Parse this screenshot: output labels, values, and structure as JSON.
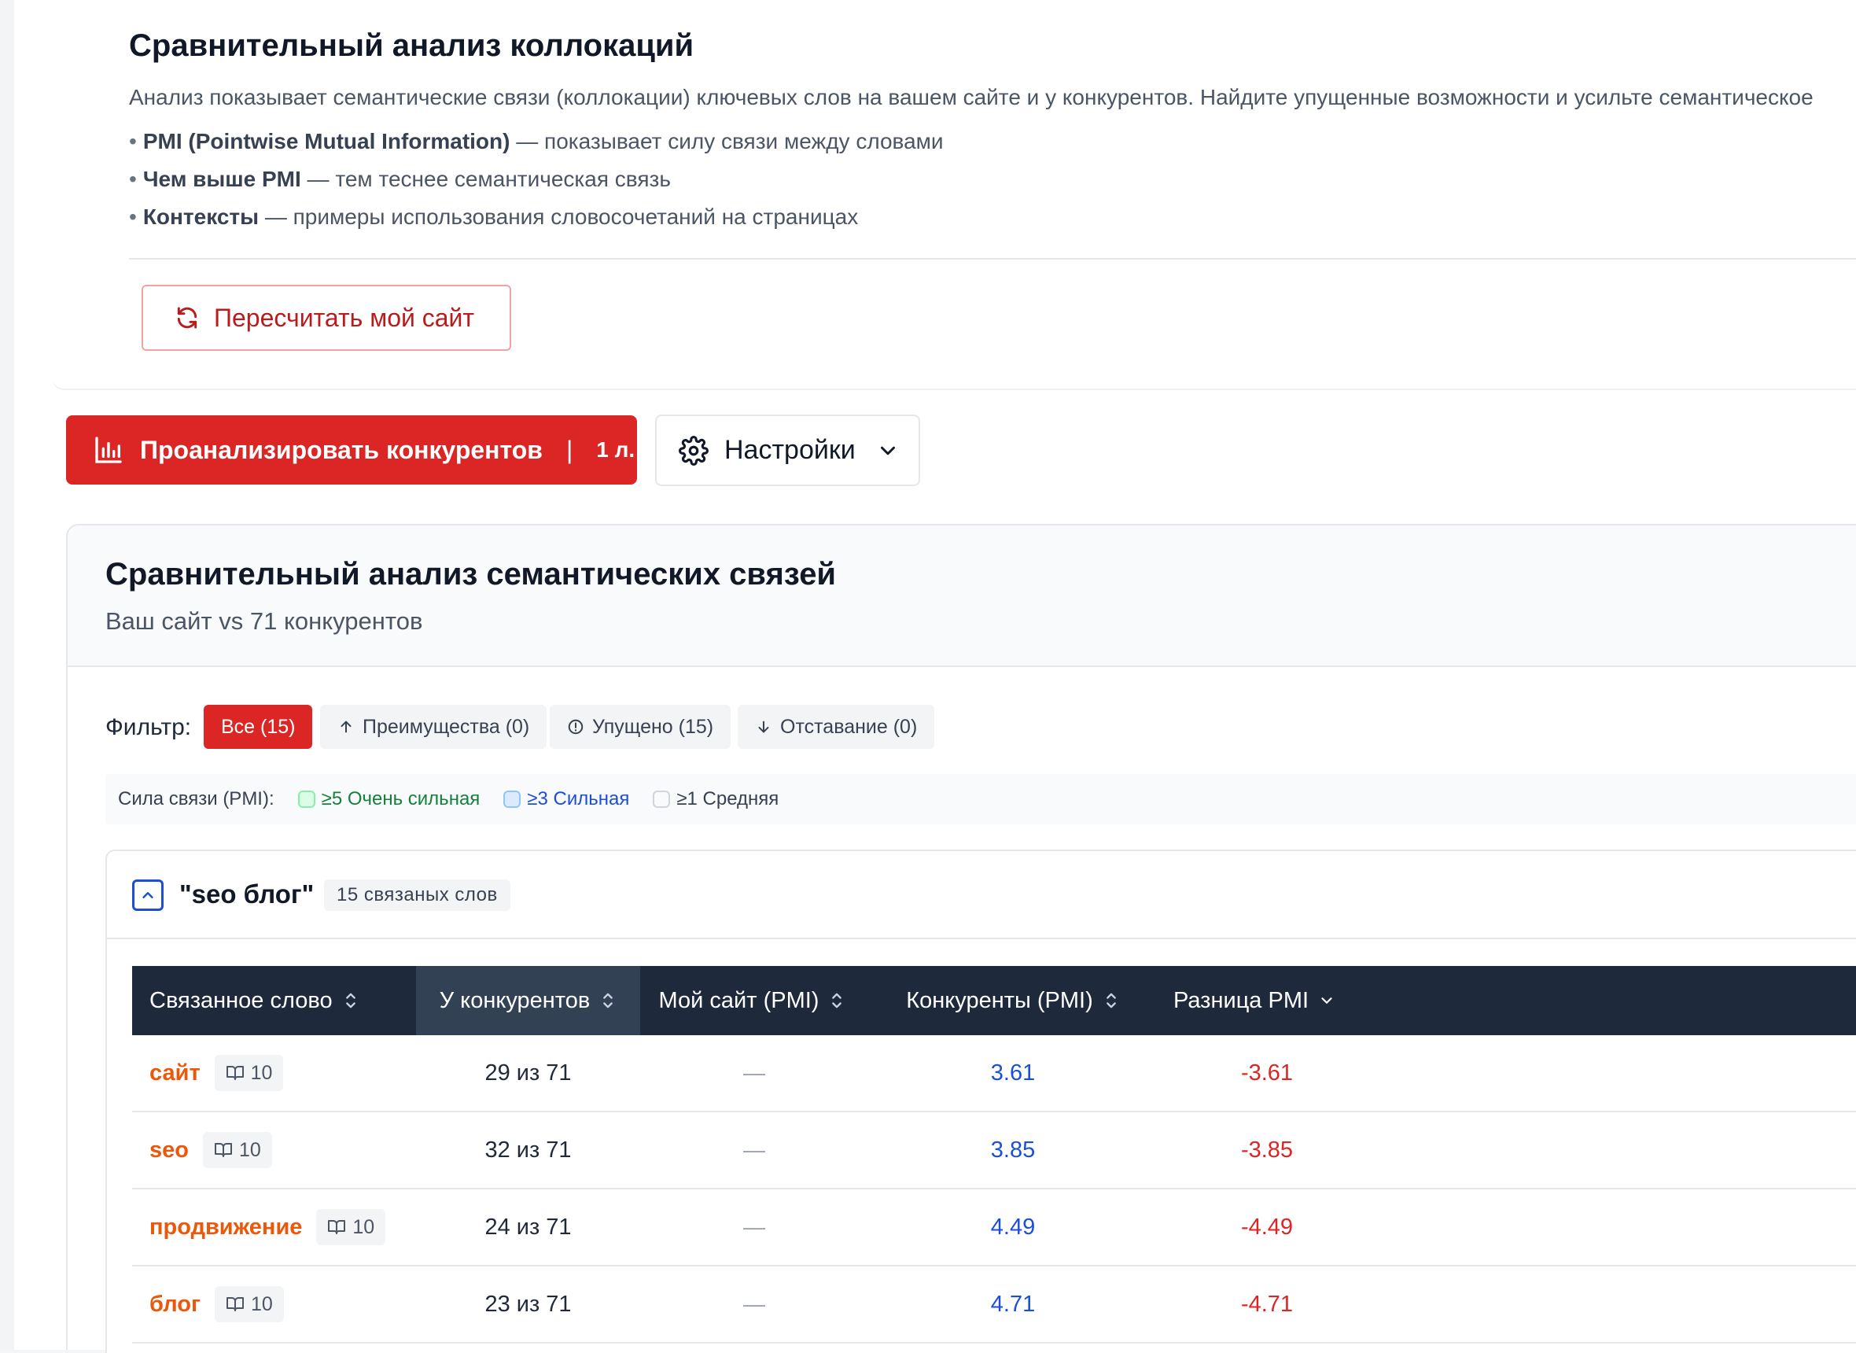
{
  "info": {
    "title": "Сравнительный анализ коллокаций",
    "description": "Анализ показывает семантические связи (коллокации) ключевых слов на вашем сайте и у конкурентов. Найдите упущенные возможности и усильте семантическое",
    "bullets": [
      {
        "bold": "PMI (Pointwise Mutual Information)",
        "text": " — показывает силу связи между словами"
      },
      {
        "bold": "Чем выше PMI",
        "text": " — тем теснее семантическая связь"
      },
      {
        "bold": "Контексты",
        "text": " — примеры использования словосочетаний на страницах"
      }
    ],
    "recalc_label": "Пересчитать мой сайт"
  },
  "actions": {
    "analyze_label": "Проанализировать конкурентов",
    "analyze_separator": "|",
    "analyze_cost": "1 л.",
    "settings_label": "Настройки"
  },
  "comparison": {
    "title": "Сравнительный анализ семантических связей",
    "subtitle": "Ваш сайт vs 71 конкурентов",
    "filter_label": "Фильтр:",
    "filters": [
      {
        "label": "Все (15)",
        "active": true
      },
      {
        "label": "Преимущества (0)",
        "icon": "arrow-up-icon"
      },
      {
        "label": "Упущено (15)",
        "icon": "alert-circle-icon"
      },
      {
        "label": "Отставание (0)",
        "icon": "arrow-down-icon"
      }
    ],
    "legend": {
      "label": "Сила связи (PMI):",
      "items": [
        {
          "label": "≥5 Очень сильная",
          "color": "#15803d"
        },
        {
          "label": "≥3 Сильная",
          "color": "#1d4ed8"
        },
        {
          "label": "≥1 Средняя",
          "color": "#374151"
        }
      ]
    },
    "group": {
      "keyword": "\"seo блог\"",
      "count_label": "15 связаных слов",
      "columns": [
        {
          "label": "Связанное слово",
          "sort": "both"
        },
        {
          "label": "У конкурентов",
          "sort": "both"
        },
        {
          "label": "Мой сайт (PMI)",
          "sort": "both"
        },
        {
          "label": "Конкуренты (PMI)",
          "sort": "both"
        },
        {
          "label": "Разница PMI",
          "sort": "desc"
        }
      ],
      "rows": [
        {
          "word": "сайт",
          "contexts": "10",
          "competitors": "29 из 71",
          "my_pmi": "—",
          "comp_pmi": "3.61",
          "diff": "-3.61"
        },
        {
          "word": "seo",
          "contexts": "10",
          "competitors": "32 из 71",
          "my_pmi": "—",
          "comp_pmi": "3.85",
          "diff": "-3.85"
        },
        {
          "word": "продвижение",
          "contexts": "10",
          "competitors": "24 из 71",
          "my_pmi": "—",
          "comp_pmi": "4.49",
          "diff": "-4.49"
        },
        {
          "word": "блог",
          "contexts": "10",
          "competitors": "23 из 71",
          "my_pmi": "—",
          "comp_pmi": "4.71",
          "diff": "-4.71"
        }
      ]
    }
  },
  "colors": {
    "accent": "#dc2626",
    "table_header": "#1e293b",
    "word": "#ea580c",
    "pmi": "#1d4ed8",
    "negative": "#dc2626"
  }
}
